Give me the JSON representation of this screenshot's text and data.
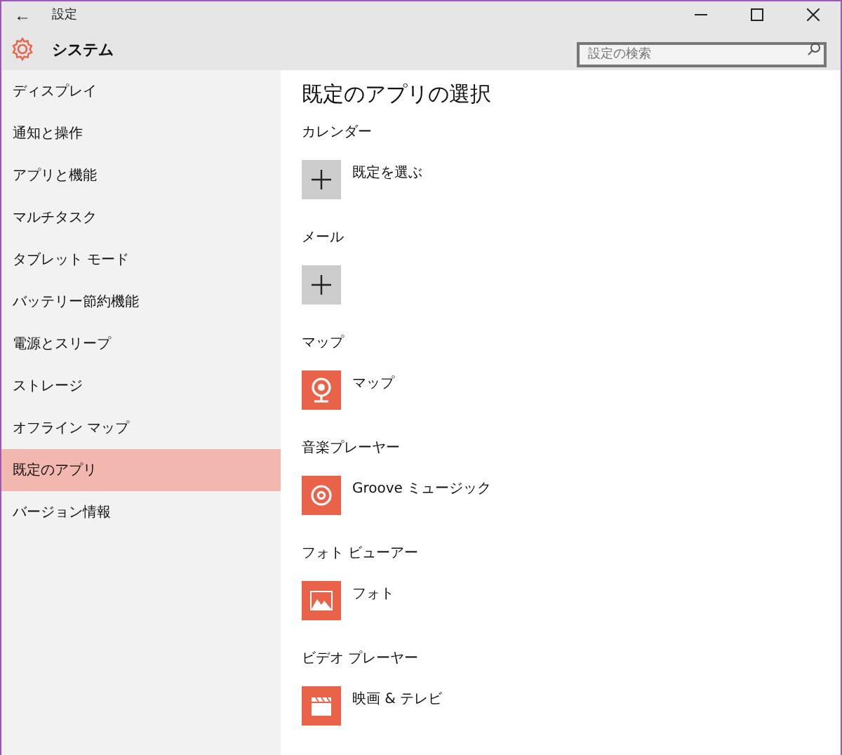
{
  "window": {
    "title": "設定",
    "back": "←"
  },
  "header": {
    "title": "システム",
    "search": {
      "placeholder": "設定の検索"
    }
  },
  "sidebar": {
    "items": [
      {
        "label": "ディスプレイ",
        "selected": false
      },
      {
        "label": "通知と操作",
        "selected": false
      },
      {
        "label": "アプリと機能",
        "selected": false
      },
      {
        "label": "マルチタスク",
        "selected": false
      },
      {
        "label": "タブレット モード",
        "selected": false
      },
      {
        "label": "バッテリー節約機能",
        "selected": false
      },
      {
        "label": "電源とスリープ",
        "selected": false
      },
      {
        "label": "ストレージ",
        "selected": false
      },
      {
        "label": "オフライン マップ",
        "selected": false
      },
      {
        "label": "既定のアプリ",
        "selected": true
      },
      {
        "label": "バージョン情報",
        "selected": false
      }
    ]
  },
  "content": {
    "title": "既定のアプリの選択",
    "sections": [
      {
        "label": "カレンダー",
        "kind": "add",
        "app": "既定を選ぶ"
      },
      {
        "label": "メール",
        "kind": "add"
      },
      {
        "label": "マップ",
        "kind": "map",
        "app": "マップ"
      },
      {
        "label": "音楽プレーヤー",
        "kind": "music",
        "app": "Groove ミュージック"
      },
      {
        "label": "フォト ビューアー",
        "kind": "photo",
        "app": "フォト"
      },
      {
        "label": "ビデオ プレーヤー",
        "kind": "video",
        "app": "映画 & テレビ"
      }
    ]
  }
}
